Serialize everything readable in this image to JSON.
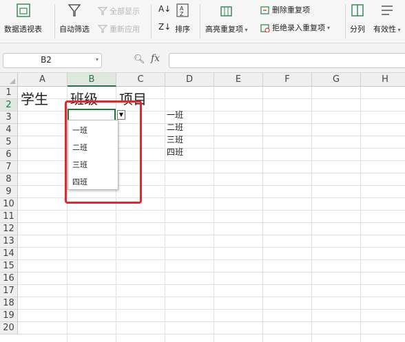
{
  "ribbon": {
    "pivot": "数据透视表",
    "autofilter": "自动筛选",
    "show_all": "全部显示",
    "reapply": "重新应用",
    "sort": "排序",
    "highlight_dup": "高亮重复项",
    "delete_dup": "删除重复项",
    "reject_dup": "拒绝录入重复项",
    "split": "分列",
    "validity": "有效性"
  },
  "formula_bar": {
    "name_box": "B2",
    "fx_label": "fx",
    "formula": ""
  },
  "sheet": {
    "columns": [
      "A",
      "B",
      "C",
      "D",
      "E",
      "F",
      "G",
      "H"
    ],
    "selected_column": "B",
    "rows": [
      "1",
      "2",
      "3",
      "4",
      "5",
      "6",
      "7",
      "8",
      "9",
      "10",
      "11",
      "12",
      "13",
      "14",
      "15",
      "16",
      "17",
      "18",
      "19",
      "20"
    ],
    "selected_row": "2",
    "cells": {
      "A1": "学生",
      "B1": "班级",
      "C1": "项目",
      "D2": "一班",
      "D3": "二班",
      "D4": "三班",
      "D5": "四班"
    }
  },
  "dropdown": {
    "options": [
      "一班",
      "二班",
      "三班",
      "四班"
    ]
  },
  "colors": {
    "accent": "#217346",
    "highlight": "#e8262a"
  }
}
